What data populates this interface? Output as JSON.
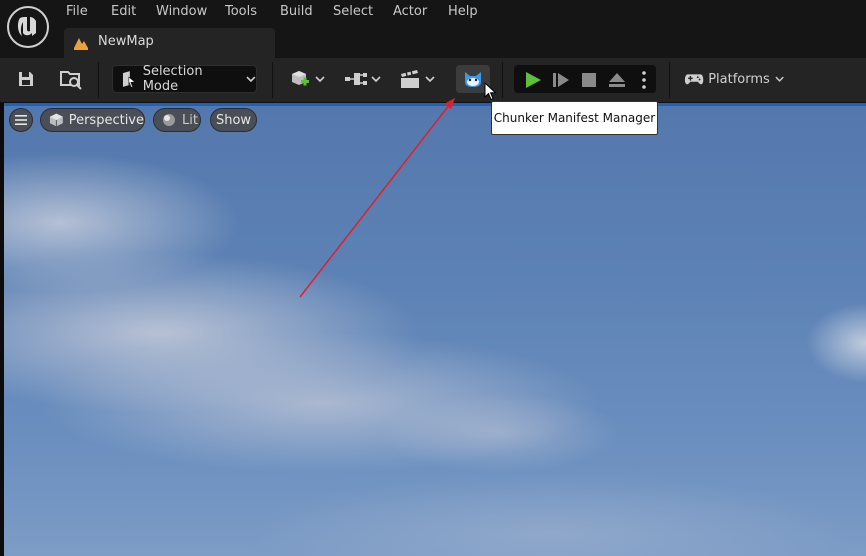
{
  "menu": {
    "items": [
      {
        "label": "File"
      },
      {
        "label": "Edit"
      },
      {
        "label": "Window"
      },
      {
        "label": "Tools"
      },
      {
        "label": "Build"
      },
      {
        "label": "Select"
      },
      {
        "label": "Actor"
      },
      {
        "label": "Help"
      }
    ]
  },
  "tab": {
    "label": "NewMap"
  },
  "toolbar": {
    "selection_mode_label": "Selection Mode",
    "platforms_label": "Platforms"
  },
  "tooltip": {
    "text": "Chunker Manifest Manager"
  },
  "viewport": {
    "perspective_label": "Perspective",
    "lit_label": "Lit",
    "show_label": "Show"
  },
  "colors": {
    "play_green": "#5fbf3a",
    "annotation_arrow": "#e0202a",
    "viewport_accent": "#1565c8"
  }
}
